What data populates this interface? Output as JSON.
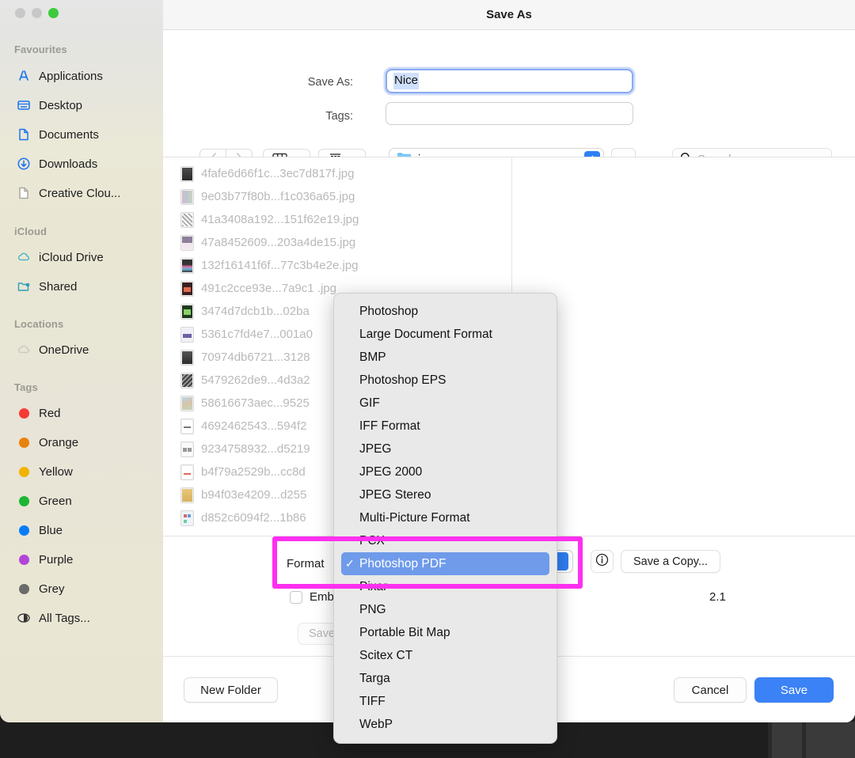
{
  "window": {
    "title": "Save As",
    "traffic_lights": [
      "close",
      "minimize",
      "maximize"
    ]
  },
  "sidebar": {
    "sections": [
      {
        "heading": "Favourites",
        "items": [
          {
            "label": "Applications",
            "icon": "applications-icon"
          },
          {
            "label": "Desktop",
            "icon": "desktop-icon"
          },
          {
            "label": "Documents",
            "icon": "document-icon"
          },
          {
            "label": "Downloads",
            "icon": "download-icon"
          },
          {
            "label": "Creative Clou...",
            "icon": "file-icon"
          }
        ]
      },
      {
        "heading": "iCloud",
        "items": [
          {
            "label": "iCloud Drive",
            "icon": "cloud-icon"
          },
          {
            "label": "Shared",
            "icon": "shared-folder-icon"
          }
        ]
      },
      {
        "heading": "Locations",
        "items": [
          {
            "label": "OneDrive",
            "icon": "cloud-icon"
          }
        ]
      },
      {
        "heading": "Tags",
        "items": [
          {
            "label": "Red",
            "icon": "tag-dot-icon",
            "color": "#f63b36"
          },
          {
            "label": "Orange",
            "icon": "tag-dot-icon",
            "color": "#e8820c"
          },
          {
            "label": "Yellow",
            "icon": "tag-dot-icon",
            "color": "#f0b400"
          },
          {
            "label": "Green",
            "icon": "tag-dot-icon",
            "color": "#1bb634"
          },
          {
            "label": "Blue",
            "icon": "tag-dot-icon",
            "color": "#067df7"
          },
          {
            "label": "Purple",
            "icon": "tag-dot-icon",
            "color": "#b344d8"
          },
          {
            "label": "Grey",
            "icon": "tag-dot-icon",
            "color": "#6b6b6b"
          },
          {
            "label": "All Tags...",
            "icon": "all-tags-icon",
            "color": ""
          }
        ]
      }
    ]
  },
  "form": {
    "save_as_label": "Save As:",
    "save_as_value": "Nice",
    "tags_label": "Tags:",
    "tags_value": ""
  },
  "toolbar": {
    "back_icon": "chevron-left-icon",
    "forward_icon": "chevron-right-icon",
    "view_column_icon": "column-view-icon",
    "view_group_icon": "group-view-icon",
    "path_folder": "imgs",
    "up_icon": "chevron-up-icon",
    "search_placeholder": "Search",
    "search_value": "",
    "search_icon": "search-icon"
  },
  "files": [
    {
      "name": "4fafe6d66f1c...3ec7d817f.jpg"
    },
    {
      "name": "9e03b77f80b...f1c036a65.jpg"
    },
    {
      "name": "41a3408a192...151f62e19.jpg"
    },
    {
      "name": "47a8452609...203a4de15.jpg"
    },
    {
      "name": "132f16141f6f...77c3b4e2e.jpg"
    },
    {
      "name": "491c2cce93e...7a9c1  .jpg"
    },
    {
      "name": "3474d7dcb1b...02ba"
    },
    {
      "name": "5361c7fd4e7...001a0"
    },
    {
      "name": "70974db6721...3128"
    },
    {
      "name": "5479262de9...4d3a2"
    },
    {
      "name": "58616673aec...9525"
    },
    {
      "name": "4692462543...594f2"
    },
    {
      "name": "9234758932...d5219"
    },
    {
      "name": "b4f79a2529b...cc8d"
    },
    {
      "name": "b94f03e4209...d255"
    },
    {
      "name": "d852c6094f2...1b86"
    }
  ],
  "options": {
    "format_label": "Format",
    "format_value": "Photoshop PDF",
    "info_icon": "info-icon",
    "save_copy_label": "Save a Copy...",
    "embed_label": "Emb",
    "embed_checked": false,
    "version_text": "2.1",
    "save_settings_label": "Save"
  },
  "format_menu": {
    "items": [
      {
        "label": "Photoshop",
        "selected": false
      },
      {
        "label": "Large Document Format",
        "selected": false
      },
      {
        "label": "BMP",
        "selected": false
      },
      {
        "label": "Photoshop EPS",
        "selected": false
      },
      {
        "label": "GIF",
        "selected": false
      },
      {
        "label": "IFF Format",
        "selected": false
      },
      {
        "label": "JPEG",
        "selected": false
      },
      {
        "label": "JPEG 2000",
        "selected": false
      },
      {
        "label": "JPEG Stereo",
        "selected": false
      },
      {
        "label": "Multi-Picture Format",
        "selected": false
      },
      {
        "label": "PCX",
        "selected": false
      },
      {
        "label": "Photoshop PDF",
        "selected": true
      },
      {
        "label": "Pixar",
        "selected": false
      },
      {
        "label": "PNG",
        "selected": false
      },
      {
        "label": "Portable Bit Map",
        "selected": false
      },
      {
        "label": "Scitex CT",
        "selected": false
      },
      {
        "label": "Targa",
        "selected": false
      },
      {
        "label": "TIFF",
        "selected": false
      },
      {
        "label": "WebP",
        "selected": false
      }
    ],
    "check_glyph": "✓"
  },
  "actions": {
    "new_folder_label": "New Folder",
    "cancel_label": "Cancel",
    "save_label": "Save"
  },
  "colors": {
    "accent_blue": "#3b82f6",
    "menu_selection": "#6f9bea",
    "annotation_magenta": "#ff2ff0",
    "text_selection": "#cfe0fb"
  }
}
